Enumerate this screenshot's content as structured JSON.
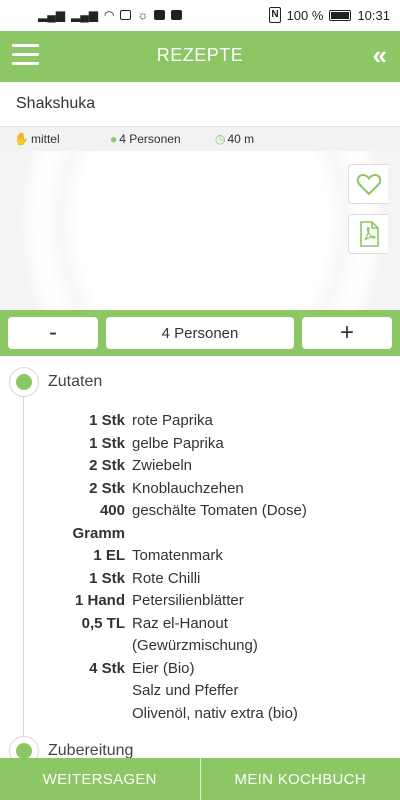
{
  "status_bar": {
    "nfc": "N",
    "battery_percent": "100 %",
    "time": "10:31"
  },
  "header": {
    "title": "REZEPTE",
    "menu_icon": "hamburger-menu-icon",
    "back_icon": "double-chevron-left-icon",
    "back_glyph": "«"
  },
  "recipe": {
    "title": "Shakshuka",
    "meta": {
      "difficulty": "mittel",
      "persons": "4 Personen",
      "time": "40 m"
    }
  },
  "portion": {
    "minus_label": "-",
    "value": "4 Personen",
    "plus_label": "+"
  },
  "sections": {
    "ingredients_label": "Zutaten",
    "preparation_label": "Zubereitung"
  },
  "ingredients": [
    {
      "qty": "1 Stk",
      "name": "rote Paprika"
    },
    {
      "qty": "1 Stk",
      "name": "gelbe Paprika"
    },
    {
      "qty": "2 Stk",
      "name": "Zwiebeln"
    },
    {
      "qty": "2 Stk",
      "name": "Knoblauchzehen"
    },
    {
      "qty": "400",
      "qty2": "Gramm",
      "name": "geschälte Tomaten (Dose)"
    },
    {
      "qty": "1 EL",
      "name": "Tomatenmark"
    },
    {
      "qty": "1 Stk",
      "name": "Rote Chilli"
    },
    {
      "qty": "1 Hand",
      "name": "Petersilienblätter"
    },
    {
      "qty": "0,5 TL",
      "name": "Raz el-Hanout",
      "name2": "(Gewürzmischung)"
    },
    {
      "qty": "4 Stk",
      "name": "Eier (Bio)"
    },
    {
      "qty": "",
      "name": "Salz und Pfeffer"
    },
    {
      "qty": "",
      "name": "Olivenöl, nativ extra (bio)"
    }
  ],
  "bottom_bar": {
    "share_label": "WEITERSAGEN",
    "cookbook_label": "MEIN KOCHBUCH"
  },
  "colors": {
    "accent": "#8cc665"
  }
}
